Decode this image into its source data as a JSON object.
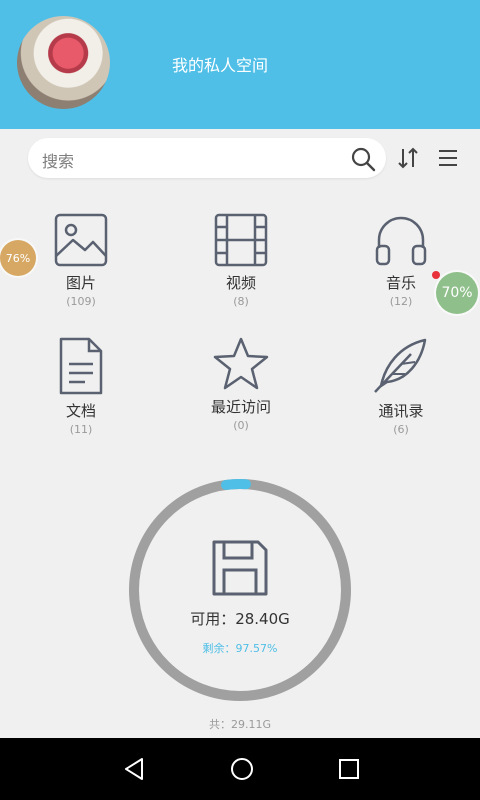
{
  "header": {
    "title": "我的私人空间"
  },
  "search": {
    "placeholder": "搜索"
  },
  "categories": [
    {
      "label": "图片",
      "count": "(109)",
      "icon": "image-icon"
    },
    {
      "label": "视频",
      "count": "(8)",
      "icon": "film-icon"
    },
    {
      "label": "音乐",
      "count": "(12)",
      "icon": "headphones-icon"
    },
    {
      "label": "文档",
      "count": "(11)",
      "icon": "document-icon"
    },
    {
      "label": "最近访问",
      "count": "(0)",
      "icon": "star-icon"
    },
    {
      "label": "通讯录",
      "count": "(6)",
      "icon": "feather-icon"
    }
  ],
  "floating_badges": {
    "left": "76%",
    "right": "70%"
  },
  "storage": {
    "available": "可用：28.40G",
    "remaining": "剩余：97.57%",
    "total": "共：29.11G"
  },
  "colors": {
    "accent": "#4fbfe7",
    "ring": "#a0a0a0",
    "icon": "#5a6170"
  }
}
